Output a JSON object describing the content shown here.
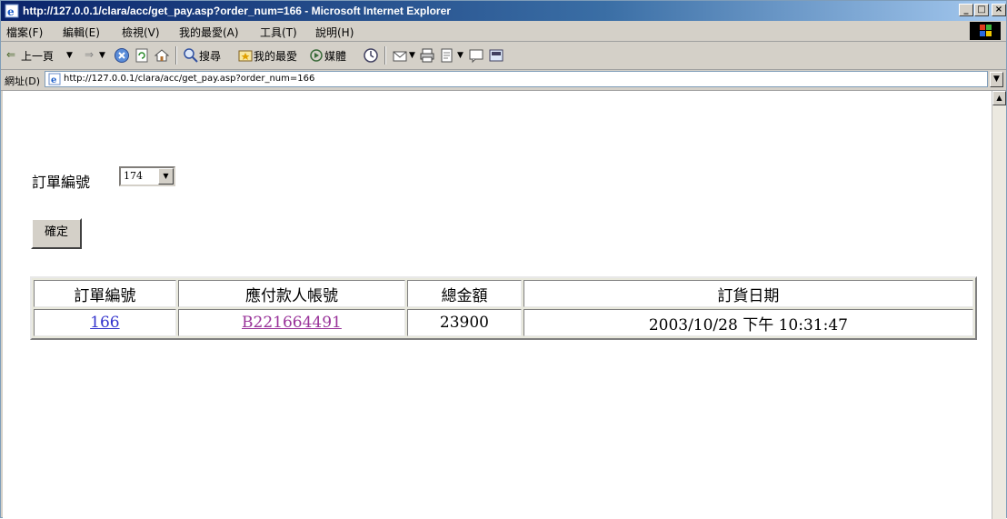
{
  "window": {
    "title": "http://127.0.0.1/clara/acc/get_pay.asp?order_num=166 - Microsoft Internet Explorer",
    "minimize": "_",
    "maximize": "□",
    "close": "×"
  },
  "menu": [
    "檔案(F)",
    "編輯(E)",
    "檢視(V)",
    "我的最愛(A)",
    "工具(T)",
    "說明(H)"
  ],
  "toolbar": {
    "back_label": "上一頁",
    "search_label": "搜尋",
    "favorites_label": "我的最愛",
    "media_label": "媒體"
  },
  "address": {
    "label": "網址(D)",
    "url": "http://127.0.0.1/clara/acc/get_pay.asp?order_num=166"
  },
  "form": {
    "order_label": "訂單編號",
    "selected_order": "174",
    "confirm_label": "確定"
  },
  "table": {
    "headers": [
      "訂單編號",
      "應付款人帳號",
      "總金額",
      "訂貨日期"
    ],
    "rows": [
      [
        "166",
        "B221664491",
        "23900",
        "2003/10/28 下午 10:31:47"
      ]
    ]
  },
  "colors": {
    "link": "#3333cc",
    "visited_link": "#993399",
    "title_bar": "#0a246a"
  }
}
